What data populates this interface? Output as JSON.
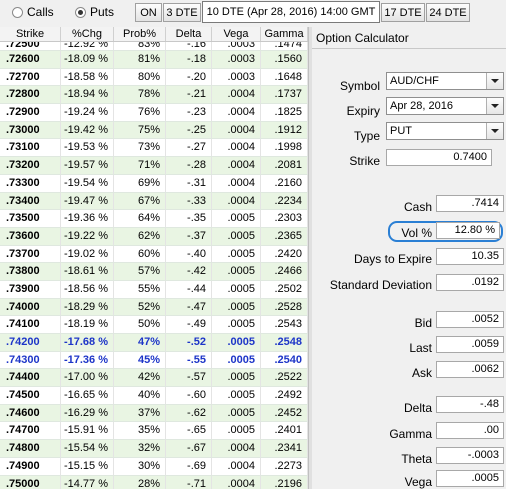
{
  "options_type": {
    "calls_label": "Calls",
    "puts_label": "Puts",
    "selected": "Puts"
  },
  "expiry_buttons": [
    {
      "label": "ON",
      "active": false
    },
    {
      "label": "3 DTE",
      "active": false
    },
    {
      "label": "10 DTE (Apr 28, 2016) 14:00 GMT",
      "active": true
    },
    {
      "label": "17 DTE",
      "active": false
    },
    {
      "label": "24 DTE",
      "active": false
    }
  ],
  "table": {
    "columns": [
      "Strike",
      "%Chg",
      "Prob%",
      "Delta",
      "Vega",
      "Gamma"
    ],
    "partial_top_row": [
      ".72500",
      "-12.92 %",
      "83%",
      "-.16",
      ".0003",
      ".1474"
    ],
    "rows": [
      [
        ".72600",
        "-18.09 %",
        "81%",
        "-.18",
        ".0003",
        ".1560"
      ],
      [
        ".72700",
        "-18.58 %",
        "80%",
        "-.20",
        ".0003",
        ".1648"
      ],
      [
        ".72800",
        "-18.94 %",
        "78%",
        "-.21",
        ".0004",
        ".1737"
      ],
      [
        ".72900",
        "-19.24 %",
        "76%",
        "-.23",
        ".0004",
        ".1825"
      ],
      [
        ".73000",
        "-19.42 %",
        "75%",
        "-.25",
        ".0004",
        ".1912"
      ],
      [
        ".73100",
        "-19.53 %",
        "73%",
        "-.27",
        ".0004",
        ".1998"
      ],
      [
        ".73200",
        "-19.57 %",
        "71%",
        "-.28",
        ".0004",
        ".2081"
      ],
      [
        ".73300",
        "-19.54 %",
        "69%",
        "-.31",
        ".0004",
        ".2160"
      ],
      [
        ".73400",
        "-19.47 %",
        "67%",
        "-.33",
        ".0004",
        ".2234"
      ],
      [
        ".73500",
        "-19.36 %",
        "64%",
        "-.35",
        ".0005",
        ".2303"
      ],
      [
        ".73600",
        "-19.22 %",
        "62%",
        "-.37",
        ".0005",
        ".2365"
      ],
      [
        ".73700",
        "-19.02 %",
        "60%",
        "-.40",
        ".0005",
        ".2420"
      ],
      [
        ".73800",
        "-18.61 %",
        "57%",
        "-.42",
        ".0005",
        ".2466"
      ],
      [
        ".73900",
        "-18.56 %",
        "55%",
        "-.44",
        ".0005",
        ".2502"
      ],
      [
        ".74000",
        "-18.29 %",
        "52%",
        "-.47",
        ".0005",
        ".2528"
      ],
      [
        ".74100",
        "-18.19 %",
        "50%",
        "-.49",
        ".0005",
        ".2543"
      ],
      [
        ".74200",
        "-17.68 %",
        "47%",
        "-.52",
        ".0005",
        ".2548"
      ],
      [
        ".74300",
        "-17.36 %",
        "45%",
        "-.55",
        ".0005",
        ".2540"
      ],
      [
        ".74400",
        "-17.00 %",
        "42%",
        "-.57",
        ".0005",
        ".2522"
      ],
      [
        ".74500",
        "-16.65 %",
        "40%",
        "-.60",
        ".0005",
        ".2492"
      ],
      [
        ".74600",
        "-16.29 %",
        "37%",
        "-.62",
        ".0005",
        ".2452"
      ],
      [
        ".74700",
        "-15.91 %",
        "35%",
        "-.65",
        ".0005",
        ".2401"
      ],
      [
        ".74800",
        "-15.54 %",
        "32%",
        "-.67",
        ".0004",
        ".2341"
      ],
      [
        ".74900",
        "-15.15 %",
        "30%",
        "-.69",
        ".0004",
        ".2273"
      ],
      [
        ".75000",
        "-14.77 %",
        "28%",
        "-.71",
        ".0004",
        ".2196"
      ]
    ],
    "highlighted_strikes": [
      ".74200",
      ".74300"
    ],
    "highlight_color": "#1d35c8",
    "stripe_color": "#e9f5e3"
  },
  "calculator": {
    "title": "Option Calculator",
    "symbol_label": "Symbol",
    "symbol_value": "AUD/CHF",
    "expiry_label": "Expiry",
    "expiry_value": "Apr 28, 2016",
    "type_label": "Type",
    "type_value": "PUT",
    "strike_label": "Strike",
    "strike_value": "0.7400",
    "cash_label": "Cash",
    "cash_value": ".7414",
    "vol_label": "Vol %",
    "vol_value": "12.80 %",
    "days_label": "Days to Expire",
    "days_value": "10.35",
    "stddev_label": "Standard Deviation",
    "stddev_value": ".0192",
    "bid_label": "Bid",
    "bid_value": ".0052",
    "last_label": "Last",
    "last_value": ".0059",
    "ask_label": "Ask",
    "ask_value": ".0062",
    "delta_label": "Delta",
    "delta_value": "-.48",
    "gamma_label": "Gamma",
    "gamma_value": ".00",
    "theta_label": "Theta",
    "theta_value": "-.0003",
    "vega_label": "Vega",
    "vega_value": ".0005",
    "vol_ring_color": "#2a7fd4"
  }
}
